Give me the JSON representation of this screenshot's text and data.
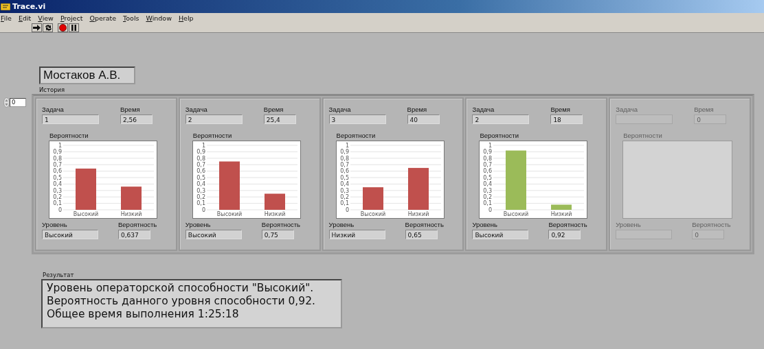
{
  "window": {
    "title": "Trace.vi"
  },
  "menu": [
    "File",
    "Edit",
    "View",
    "Project",
    "Operate",
    "Tools",
    "Window",
    "Help"
  ],
  "name_field": {
    "value": "Мостаков А.В."
  },
  "history": {
    "label": "История",
    "index": "0",
    "elements": [
      {
        "disabled": false,
        "task_label": "Задача",
        "task": "1",
        "time_label": "Время",
        "time": "2,56",
        "chart_label": "Вероятности",
        "level_label": "Уровень",
        "level_value": "Высокий",
        "prob_label": "Вероятность",
        "prob": "0,637",
        "chart_data": {
          "type": "bar",
          "categories": [
            "Высокий",
            "Низкий"
          ],
          "grid": true,
          "series": [
            {
              "color": "#c0504d",
              "values": [
                0.64,
                0.36
              ]
            }
          ],
          "ylim": [
            0,
            1
          ],
          "yticks": [
            {
              "value": 0,
              "label": "0"
            },
            {
              "value": 0.1,
              "label": "0,1"
            },
            {
              "value": 0.2,
              "label": "0,2"
            },
            {
              "value": 0.3,
              "label": "0,3"
            },
            {
              "value": 0.4,
              "label": "0,4"
            },
            {
              "value": 0.5,
              "label": "0,5"
            },
            {
              "value": 0.6,
              "label": "0,6"
            },
            {
              "value": 0.7,
              "label": "0,7"
            },
            {
              "value": 0.8,
              "label": "0,8"
            },
            {
              "value": 0.9,
              "label": "0,9"
            },
            {
              "value": 1,
              "label": "1"
            }
          ]
        }
      },
      {
        "disabled": false,
        "task_label": "Задача",
        "task": "2",
        "time_label": "Время",
        "time": "25,4",
        "chart_label": "Вероятности",
        "level_label": "Уровень",
        "level_value": "Высокий",
        "prob_label": "Вероятность",
        "prob": "0,75",
        "chart_data": {
          "type": "bar",
          "categories": [
            "Высокий",
            "Низкий"
          ],
          "grid": true,
          "series": [
            {
              "color": "#c0504d",
              "values": [
                0.75,
                0.25
              ]
            }
          ],
          "ylim": [
            0,
            1
          ],
          "yticks": [
            {
              "value": 0,
              "label": "0"
            },
            {
              "value": 0.1,
              "label": "0,1"
            },
            {
              "value": 0.2,
              "label": "0,2"
            },
            {
              "value": 0.3,
              "label": "0,3"
            },
            {
              "value": 0.4,
              "label": "0,4"
            },
            {
              "value": 0.5,
              "label": "0,5"
            },
            {
              "value": 0.6,
              "label": "0,6"
            },
            {
              "value": 0.7,
              "label": "0,7"
            },
            {
              "value": 0.8,
              "label": "0,8"
            },
            {
              "value": 0.9,
              "label": "0,9"
            },
            {
              "value": 1,
              "label": "1"
            }
          ]
        }
      },
      {
        "disabled": false,
        "task_label": "Задача",
        "task": "3",
        "time_label": "Время",
        "time": "40",
        "chart_label": "Вероятности",
        "level_label": "Уровень",
        "level_value": "Низкий",
        "prob_label": "Вероятность",
        "prob": "0,65",
        "chart_data": {
          "type": "bar",
          "categories": [
            "Высокий",
            "Низкий"
          ],
          "grid": true,
          "series": [
            {
              "color": "#c0504d",
              "values": [
                0.35,
                0.65
              ]
            }
          ],
          "ylim": [
            0,
            1
          ],
          "yticks": [
            {
              "value": 0,
              "label": "0"
            },
            {
              "value": 0.1,
              "label": "0,1"
            },
            {
              "value": 0.2,
              "label": "0,2"
            },
            {
              "value": 0.3,
              "label": "0,3"
            },
            {
              "value": 0.4,
              "label": "0,4"
            },
            {
              "value": 0.5,
              "label": "0,5"
            },
            {
              "value": 0.6,
              "label": "0,6"
            },
            {
              "value": 0.7,
              "label": "0,7"
            },
            {
              "value": 0.8,
              "label": "0,8"
            },
            {
              "value": 0.9,
              "label": "0,9"
            },
            {
              "value": 1,
              "label": "1"
            }
          ]
        }
      },
      {
        "disabled": false,
        "task_label": "Задача",
        "task": "2",
        "time_label": "Время",
        "time": "18",
        "chart_label": "Вероятности",
        "level_label": "Уровень",
        "level_value": "Высокий",
        "prob_label": "Вероятность",
        "prob": "0,92",
        "chart_data": {
          "type": "bar",
          "categories": [
            "Высокий",
            "Низкий"
          ],
          "grid": true,
          "series": [
            {
              "color": "#9bbb59",
              "values": [
                0.92,
                0.08
              ]
            }
          ],
          "ylim": [
            0,
            1
          ],
          "yticks": [
            {
              "value": 0,
              "label": "0"
            },
            {
              "value": 0.1,
              "label": "0,1"
            },
            {
              "value": 0.2,
              "label": "0,2"
            },
            {
              "value": 0.3,
              "label": "0,3"
            },
            {
              "value": 0.4,
              "label": "0,4"
            },
            {
              "value": 0.5,
              "label": "0,5"
            },
            {
              "value": 0.6,
              "label": "0,6"
            },
            {
              "value": 0.7,
              "label": "0,7"
            },
            {
              "value": 0.8,
              "label": "0,8"
            },
            {
              "value": 0.9,
              "label": "0,9"
            },
            {
              "value": 1,
              "label": "1"
            }
          ]
        }
      },
      {
        "disabled": true,
        "task_label": "Задача",
        "time_label": "Время",
        "time": "0",
        "chart_label": "Вероятности",
        "level_label": "Уровень",
        "prob_label": "Вероятность",
        "prob": "0"
      }
    ]
  },
  "result": {
    "label": "Результат",
    "lines": [
      "Уровень операторской способности \"Высокий\".",
      "Вероятность данного уровня способности 0,92.",
      "Общее время выполнения 1:25:18"
    ]
  }
}
